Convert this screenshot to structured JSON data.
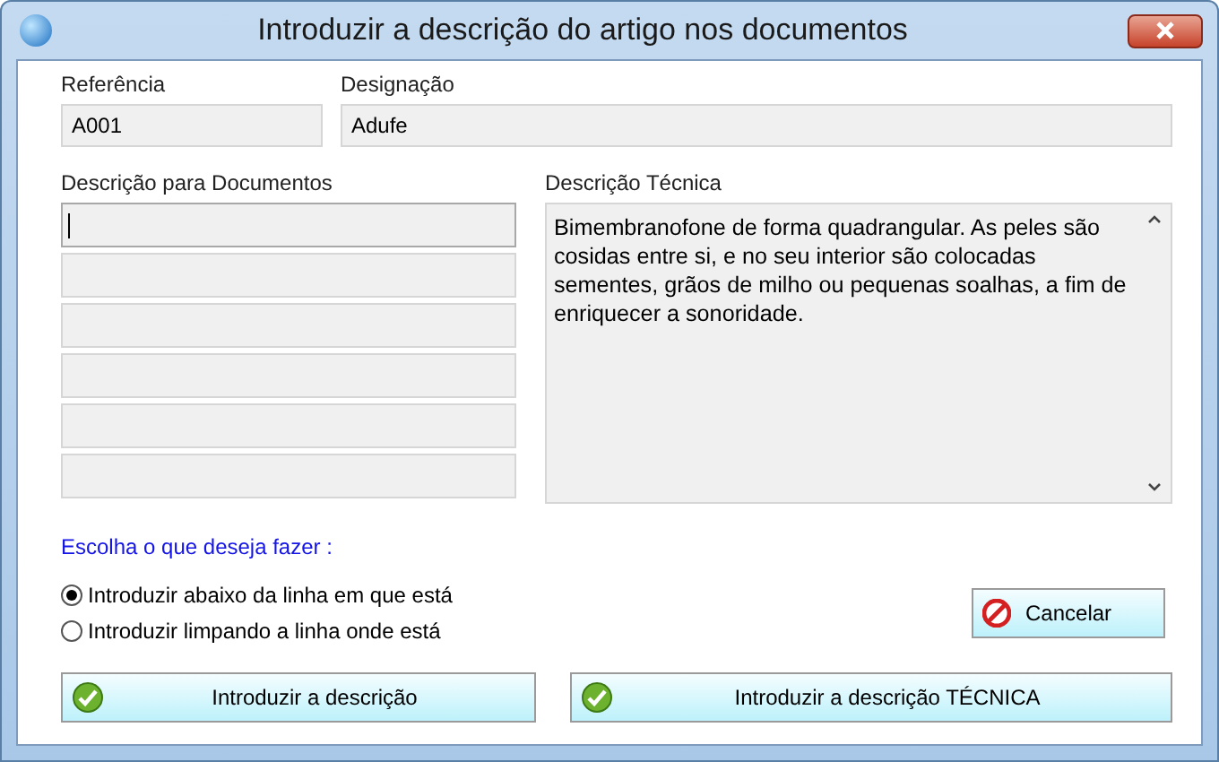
{
  "window": {
    "title": "Introduzir a descrição do artigo nos documentos"
  },
  "reference": {
    "label": "Referência",
    "value": "A001"
  },
  "designation": {
    "label": "Designação",
    "value": "Adufe"
  },
  "document_description": {
    "label": "Descrição para Documentos",
    "lines": [
      {
        "focused": true
      },
      {
        "focused": false
      },
      {
        "focused": false
      },
      {
        "focused": false
      },
      {
        "focused": false
      },
      {
        "focused": false
      }
    ]
  },
  "technical_description": {
    "label": "Descrição Técnica",
    "text": "Bimembranofone de forma quadrangular. As peles são cosidas entre si, e no seu interior são colocadas sementes, grãos de milho ou pequenas soalhas, a fim de enriquecer a sonoridade."
  },
  "prompt": "Escolha o que deseja fazer :",
  "options": [
    {
      "label": "Introduzir abaixo da linha em que está",
      "selected": true
    },
    {
      "label": "Introduzir limpando a linha onde está",
      "selected": false
    }
  ],
  "cancel_button": "Cancelar",
  "buttons": [
    "Introduzir a descrição",
    "Introduzir a descrição TÉCNICA"
  ]
}
